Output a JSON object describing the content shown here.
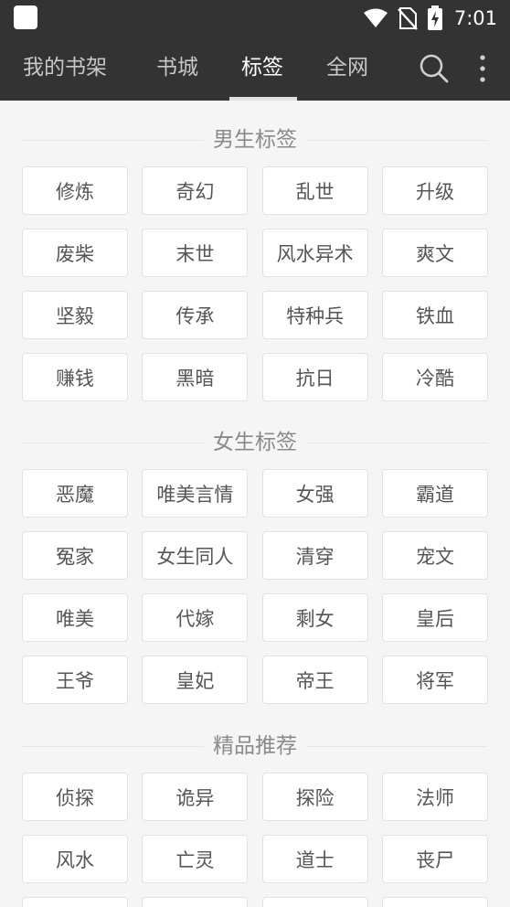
{
  "status_bar": {
    "time": "7:01",
    "icons": [
      "app-notification-icon",
      "wifi-icon",
      "no-sim-icon",
      "battery-charging-icon"
    ]
  },
  "nav": {
    "tabs": [
      {
        "label": "我的书架",
        "active": false
      },
      {
        "label": "书城",
        "active": false
      },
      {
        "label": "标签",
        "active": true
      },
      {
        "label": "全网",
        "active": false
      }
    ],
    "icons": [
      "search-icon",
      "more-vertical-icon"
    ]
  },
  "sections": [
    {
      "title": "男生标签",
      "tags": [
        "修炼",
        "奇幻",
        "乱世",
        "升级",
        "废柴",
        "末世",
        "风水异术",
        "爽文",
        "坚毅",
        "传承",
        "特种兵",
        "铁血",
        "赚钱",
        "黑暗",
        "抗日",
        "冷酷"
      ]
    },
    {
      "title": "女生标签",
      "tags": [
        "恶魔",
        "唯美言情",
        "女强",
        "霸道",
        "冤家",
        "女生同人",
        "清穿",
        "宠文",
        "唯美",
        "代嫁",
        "剩女",
        "皇后",
        "王爷",
        "皇妃",
        "帝王",
        "将军"
      ]
    },
    {
      "title": "精品推荐",
      "tags": [
        "侦探",
        "诡异",
        "探险",
        "法师",
        "风水",
        "亡灵",
        "道士",
        "丧尸"
      ]
    }
  ],
  "colors": {
    "header_bg": "#333333",
    "page_bg": "#f5f5f5",
    "tag_bg": "#ffffff",
    "tag_border": "#e1e1e1",
    "section_title": "#8a8a8a"
  }
}
